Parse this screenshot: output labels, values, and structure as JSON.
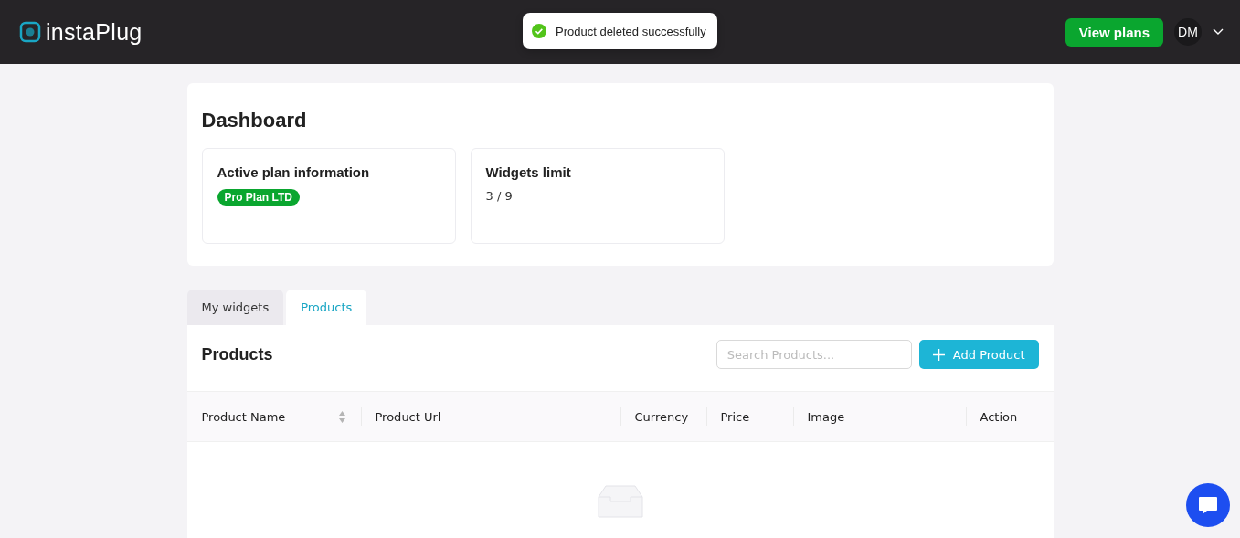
{
  "header": {
    "logo": "instaPlug",
    "view_plans": "View plans",
    "avatar": "DM"
  },
  "toast": {
    "message": "Product deleted successfully"
  },
  "dashboard": {
    "title": "Dashboard",
    "cards": [
      {
        "kind": "badge",
        "title": "Active plan information",
        "value": "Pro Plan LTD"
      },
      {
        "kind": "text",
        "title": "Widgets limit",
        "value": "3 / 9"
      }
    ]
  },
  "tabs": [
    {
      "label": "My widgets",
      "selected": false
    },
    {
      "label": "Products",
      "selected": true
    }
  ],
  "products": {
    "title": "Products",
    "search": {
      "placeholder": "Search Products..."
    },
    "add_button": "Add Product",
    "columns": [
      {
        "label": "Product Name",
        "kind": "sortable"
      },
      {
        "label": "Product Url",
        "kind": "plain"
      },
      {
        "label": "Currency",
        "kind": "plain"
      },
      {
        "label": "Price",
        "kind": "plain"
      },
      {
        "label": "Image",
        "kind": "plain"
      },
      {
        "label": "Action",
        "kind": "plain"
      }
    ]
  }
}
